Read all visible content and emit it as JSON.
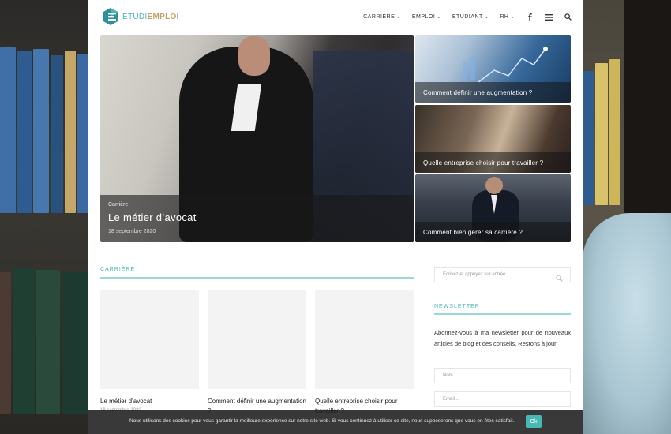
{
  "brand": {
    "name_part1": "ETUDI",
    "name_part2": "EMPLOI",
    "accent_color": "#47b9b3",
    "secondary_color": "#c2a36e"
  },
  "nav": {
    "items": [
      {
        "label": "CARRIÈRE",
        "icon": "chevron-down-icon"
      },
      {
        "label": "EMPLOI",
        "icon": "chevron-down-icon"
      },
      {
        "label": "ETUDIANT",
        "icon": "chevron-down-icon"
      },
      {
        "label": "RH",
        "icon": "chevron-down-icon"
      }
    ],
    "icons": [
      "facebook-icon",
      "menu-icon",
      "search-icon"
    ]
  },
  "hero": {
    "category": "Carrière",
    "title": "Le métier d’avocat",
    "date": "18 septembre 2020"
  },
  "side_cards": [
    {
      "title": "Comment définir une augmentation ?"
    },
    {
      "title": "Quelle entreprise choisir pour travailler ?"
    },
    {
      "title": "Comment bien gérer sa carrière ?"
    }
  ],
  "section": {
    "title": "CARRIÈRE",
    "posts": [
      {
        "title": "Le métier d’avocat",
        "date": "18 septembre 2020"
      },
      {
        "title": "Comment définir une augmentation ?",
        "date": ""
      },
      {
        "title": "Quelle entreprise choisir pour travailler ?",
        "date": ""
      }
    ]
  },
  "sidebar": {
    "search_placeholder": "Écrivez et appuyez sur entrée ...",
    "newsletter_title": "NEWSLETTER",
    "newsletter_text": "Abonnez-vous à ma newsletter pour de nouveaux articles de blog et des conseils. Restons à jour!",
    "name_placeholder": "Nom...",
    "email_placeholder": "Email..."
  },
  "cookie": {
    "message": "Nous utilisons des cookies pour vous garantir la meilleure expérience sur notre site web. Si vous continuez à utiliser ce site, nous supposerons que vous en êtes satisfait.",
    "button": "Ok"
  }
}
